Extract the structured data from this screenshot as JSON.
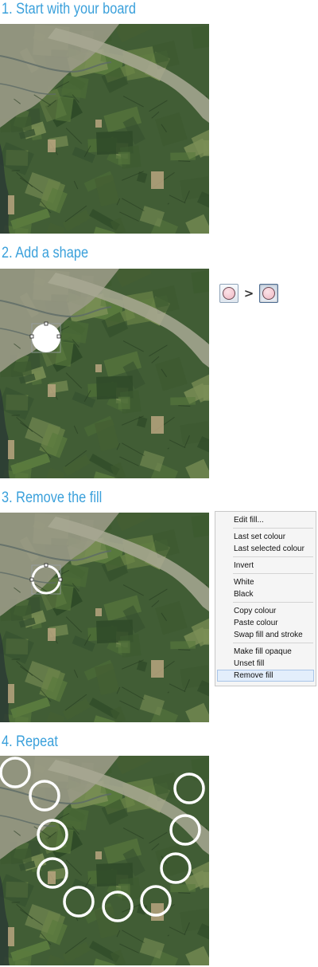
{
  "steps": [
    {
      "number": "1.",
      "title": "Start with your board"
    },
    {
      "number": "2.",
      "title": "Add a shape"
    },
    {
      "number": "3.",
      "title": "Remove the fill"
    },
    {
      "number": "4.",
      "title": "Repeat"
    }
  ],
  "step_headings": [
    "1. Start with your board",
    "2. Add a shape",
    "3. Remove the fill",
    "4. Repeat"
  ],
  "toolbar": {
    "arrow": ">",
    "fill_button_icon": "filled-circle-icon",
    "fill_button_pressed_icon": "filled-circle-icon"
  },
  "context_menu": {
    "groups": [
      [
        "Edit fill..."
      ],
      [
        "Last set colour",
        "Last selected colour"
      ],
      [
        "Invert"
      ],
      [
        "White",
        "Black"
      ],
      [
        "Copy colour",
        "Paste colour",
        "Swap fill and stroke"
      ],
      [
        "Make fill opaque",
        "Unset fill",
        "Remove fill"
      ]
    ],
    "selected_item": "Remove fill"
  },
  "colors": {
    "heading": "#3aa0db",
    "shape_stroke": "#ffffff",
    "menu_background": "#f5f5f5",
    "menu_highlight": "#e3eefb",
    "swatch_fill": "#efb7c2"
  }
}
